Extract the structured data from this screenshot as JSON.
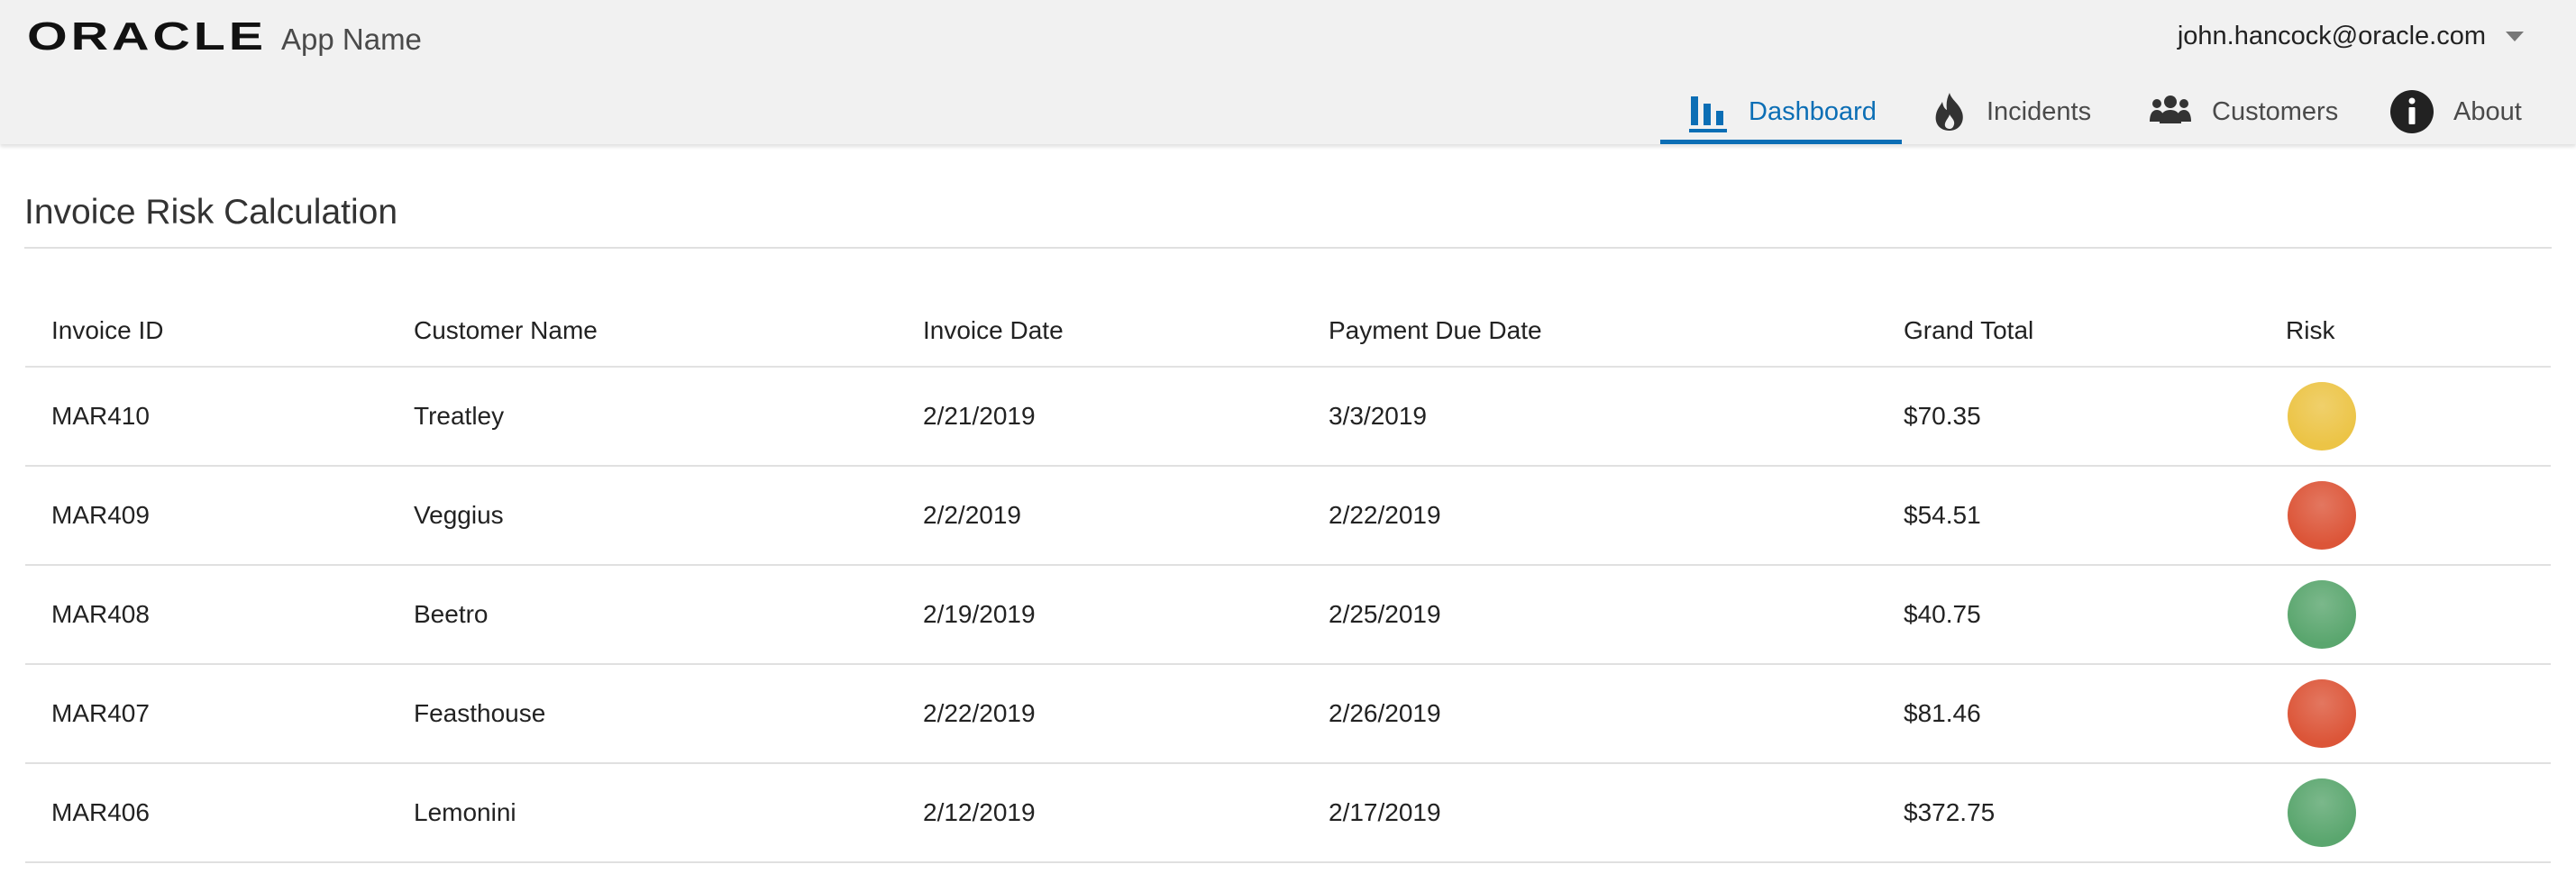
{
  "header": {
    "logo_text": "ORACLE",
    "app_name": "App Name",
    "user_email": "john.hancock@oracle.com"
  },
  "nav": {
    "items": [
      {
        "label": "Dashboard",
        "icon": "bar-chart-icon",
        "active": true
      },
      {
        "label": "Incidents",
        "icon": "fire-icon",
        "active": false
      },
      {
        "label": "Customers",
        "icon": "people-icon",
        "active": false
      },
      {
        "label": "About",
        "icon": "info-icon",
        "active": false
      }
    ]
  },
  "page": {
    "title": "Invoice Risk Calculation"
  },
  "table": {
    "columns": [
      "Invoice ID",
      "Customer Name",
      "Invoice Date",
      "Payment Due Date",
      "Grand Total",
      "Risk"
    ],
    "rows": [
      {
        "invoice_id": "MAR410",
        "customer": "Treatley",
        "invoice_date": "2/21/2019",
        "due_date": "3/3/2019",
        "total": "$70.35",
        "risk": "medium"
      },
      {
        "invoice_id": "MAR409",
        "customer": "Veggius",
        "invoice_date": "2/2/2019",
        "due_date": "2/22/2019",
        "total": "$54.51",
        "risk": "high"
      },
      {
        "invoice_id": "MAR408",
        "customer": "Beetro",
        "invoice_date": "2/19/2019",
        "due_date": "2/25/2019",
        "total": "$40.75",
        "risk": "low"
      },
      {
        "invoice_id": "MAR407",
        "customer": "Feasthouse",
        "invoice_date": "2/22/2019",
        "due_date": "2/26/2019",
        "total": "$81.46",
        "risk": "high"
      },
      {
        "invoice_id": "MAR406",
        "customer": "Lemonini",
        "invoice_date": "2/12/2019",
        "due_date": "2/17/2019",
        "total": "$372.75",
        "risk": "low"
      }
    ]
  },
  "colors": {
    "accent": "#0b6eb5",
    "risk_low": "#5aa66e",
    "risk_medium": "#ecc446",
    "risk_high": "#dc5538"
  }
}
